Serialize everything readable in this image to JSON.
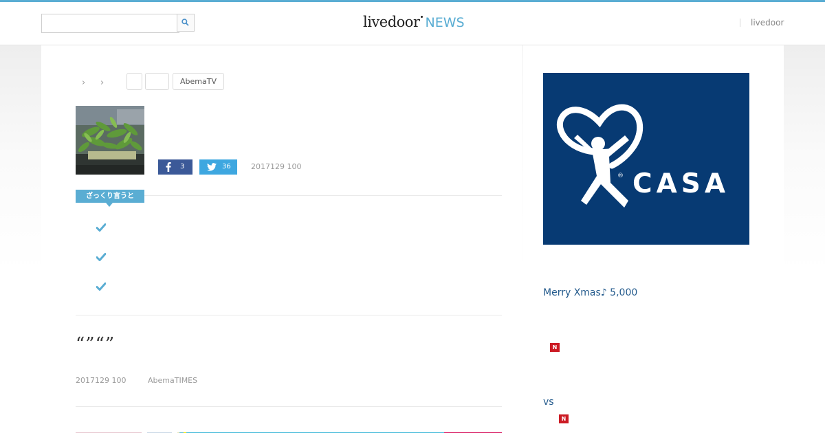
{
  "header": {
    "search": {
      "value": "",
      "placeholder": ""
    },
    "logo": {
      "main": "livedoor",
      "accent": "NEWS"
    },
    "right_link": "livedoor"
  },
  "breadcrumb": {
    "separators": [
      "›",
      "›"
    ]
  },
  "tags": [
    "",
    "",
    "AbemaTV"
  ],
  "article": {
    "share": {
      "facebook_count": "3",
      "twitter_count": "36"
    },
    "date": "2017129 100",
    "summary_label": "ざっくり言うと",
    "summary_items": [
      "",
      "",
      ""
    ]
  },
  "body": {
    "title": "“”“”",
    "date": "2017129 100",
    "source": "AbemaTIMES"
  },
  "sidebar": {
    "ad": {
      "brand": "CASA",
      "registered": "®"
    },
    "links": [
      {
        "text": "Merry Xmas♪ 5,000"
      },
      {
        "text": "",
        "badge": "N"
      },
      {
        "text": "vs"
      },
      {
        "text": "",
        "badge": "N"
      }
    ]
  },
  "colors": {
    "accent": "#5aadd3",
    "facebook": "#3b5998",
    "twitter": "#3ea7e0",
    "ad_background": "#073a73",
    "badge_red": "#cc1b24",
    "link": "#235a8c"
  }
}
